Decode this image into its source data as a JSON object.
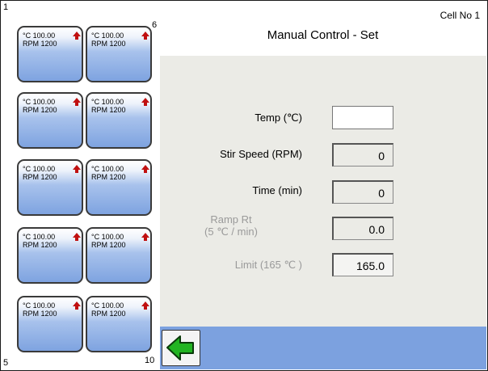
{
  "header": {
    "title": "Manual Control - Set",
    "cell_no": "Cell No 1"
  },
  "cell_panel": {
    "corner_labels": {
      "top_left": "1",
      "top_right": "6",
      "bottom_left": "5",
      "bottom_right": "10"
    },
    "cells": [
      {
        "temp": "°C 100.00",
        "rpm": "RPM 1200",
        "status_icon": "up-arrow-icon"
      },
      {
        "temp": "°C 100.00",
        "rpm": "RPM 1200",
        "status_icon": "up-arrow-icon"
      },
      {
        "temp": "°C 100.00",
        "rpm": "RPM 1200",
        "status_icon": "up-arrow-icon"
      },
      {
        "temp": "°C 100.00",
        "rpm": "RPM 1200",
        "status_icon": "up-arrow-icon"
      },
      {
        "temp": "°C 100.00",
        "rpm": "RPM 1200",
        "status_icon": "up-arrow-icon"
      },
      {
        "temp": "°C 100.00",
        "rpm": "RPM 1200",
        "status_icon": "up-arrow-icon"
      },
      {
        "temp": "°C 100.00",
        "rpm": "RPM 1200",
        "status_icon": "up-arrow-icon"
      },
      {
        "temp": "°C 100.00",
        "rpm": "RPM 1200",
        "status_icon": "up-arrow-icon"
      },
      {
        "temp": "°C 100.00",
        "rpm": "RPM 1200",
        "status_icon": "up-arrow-icon"
      },
      {
        "temp": "°C 100.00",
        "rpm": "RPM 1200",
        "status_icon": "up-arrow-icon"
      }
    ]
  },
  "form": {
    "temp": {
      "label": "Temp (℃)",
      "value": ""
    },
    "stir_speed": {
      "label": "Stir Speed (RPM)",
      "value": "0"
    },
    "time": {
      "label": "Time (min)",
      "value": "0"
    },
    "ramp_rate": {
      "label_line1": "Ramp Rt",
      "label_line2": "(5 ℃ / min)",
      "value": "0.0"
    },
    "limit": {
      "label": "Limit (165 ℃ )",
      "value": "165.0"
    }
  },
  "footer": {
    "back_icon": "green-left-arrow-icon"
  },
  "colors": {
    "cell_gradient_bottom": "#7ea3e0",
    "bottom_bar": "#7ca1df",
    "content_bg": "#ebebe6",
    "status_arrow": "#c01010",
    "back_arrow": "#22b422"
  }
}
